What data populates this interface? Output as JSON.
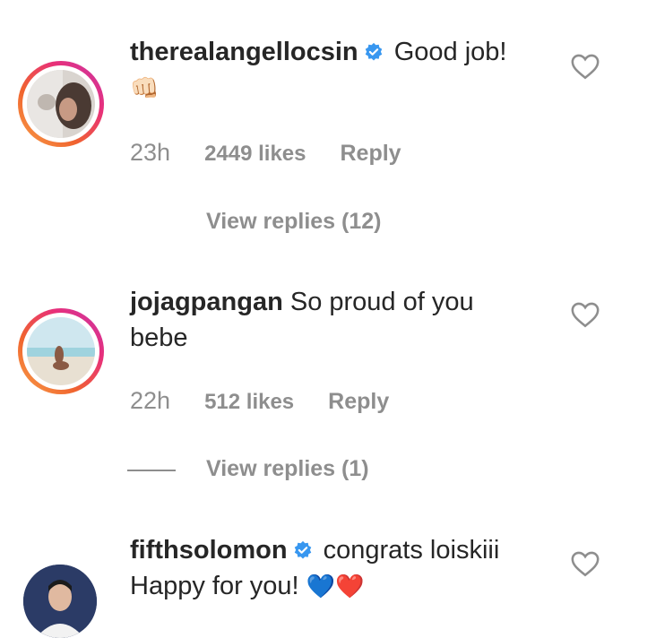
{
  "comments": [
    {
      "username": "therealangellocsin",
      "verified": true,
      "text": "Good job!",
      "emoji": "👊🏻",
      "time": "23h",
      "likes": "2449 likes",
      "reply": "Reply",
      "view_replies": "View replies (12)"
    },
    {
      "username": "jojagpangan",
      "verified": false,
      "text_line1": "So proud of you",
      "text_line2": "bebe",
      "time": "22h",
      "likes": "512 likes",
      "reply": "Reply",
      "view_replies": "View replies (1)"
    },
    {
      "username": "fifthsolomon",
      "verified": true,
      "text_line1": "congrats loiskiii",
      "text_line2": "Happy for you!",
      "hearts": "💙❤️"
    }
  ],
  "colors": {
    "verified": "#3897f0",
    "meta_text": "#8e8e8e",
    "heart_red": "#ed2939",
    "heart_blue": "#35c4ef"
  }
}
